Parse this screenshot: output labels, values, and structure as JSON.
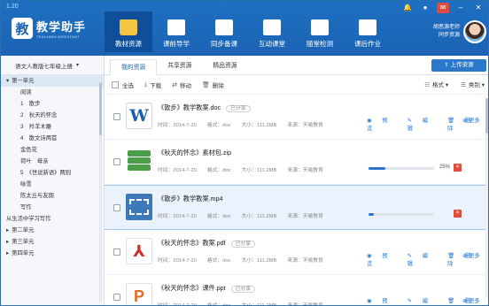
{
  "header": {
    "version": "1.20",
    "logo_glyph": "教",
    "app_title": "教学助手",
    "app_subtitle": "TEACHING ASSISTANT",
    "nav": [
      {
        "label": "教材资源",
        "icon": "folder-icon",
        "active": true
      },
      {
        "label": "课前导学",
        "icon": "book-icon",
        "active": false
      },
      {
        "label": "同步备课",
        "icon": "lesson-prep-icon",
        "active": false
      },
      {
        "label": "互动课堂",
        "icon": "classroom-icon",
        "active": false
      },
      {
        "label": "随堂检测",
        "icon": "quiz-icon",
        "active": false
      },
      {
        "label": "课后作业",
        "icon": "homework-icon",
        "active": false
      }
    ],
    "window_controls": [
      "bell-icon",
      "pin-icon",
      "mail-icon",
      "minimize-icon",
      "close-icon"
    ],
    "user_name": "胡思源老师",
    "user_sub": "同步资源"
  },
  "sidebar": {
    "book_selector": "语文人教版七年级上册",
    "tree": [
      {
        "label": "第一单元",
        "level": 0,
        "expander": "▾",
        "selected": true
      },
      {
        "label": "阅读",
        "level": 1
      },
      {
        "label": "1　散步",
        "level": 1
      },
      {
        "label": "2　秋天的怀念",
        "level": 1
      },
      {
        "label": "3　羚羊木雕",
        "level": 1
      },
      {
        "label": "4　散文诗两首",
        "level": 1
      },
      {
        "label": "金色花",
        "level": 1
      },
      {
        "label": "荷叶　母亲",
        "level": 1
      },
      {
        "label": "5　《世说新语》两则",
        "level": 1
      },
      {
        "label": "咏雪",
        "level": 1
      },
      {
        "label": "陈太丘与友期",
        "level": 1
      },
      {
        "label": "写作",
        "level": 1
      },
      {
        "label": "从生活中学习写作",
        "level": 0,
        "expander": ""
      },
      {
        "label": "第二单元",
        "level": 0,
        "expander": "▸"
      },
      {
        "label": "第三单元",
        "level": 0,
        "expander": "▸"
      },
      {
        "label": "第四单元",
        "level": 0,
        "expander": "▸"
      }
    ]
  },
  "tabs": [
    {
      "label": "我的资源",
      "active": true
    },
    {
      "label": "共享资源",
      "active": false
    },
    {
      "label": "精品资源",
      "active": false
    }
  ],
  "upload_label": "上传资源",
  "toolbar": {
    "select_all": "全选",
    "download": "下载",
    "move": "移动",
    "delete": "删除",
    "view": "格式",
    "sort": "类别"
  },
  "files": [
    {
      "name": "《散步》教学教案.doc",
      "tag": "已分享",
      "icon": "word-icon",
      "time": "时间：2014-7-20",
      "format": "格式：doc",
      "size": "大小：111.2MB",
      "source": "来源：天喻教育",
      "mode": "actions"
    },
    {
      "name": "《秋天的怀念》素材包.zip",
      "tag": "",
      "icon": "zip-icon",
      "time": "时间：2014-7-20",
      "format": "格式：doc",
      "size": "大小：111.2MB",
      "source": "来源：天喻教育",
      "mode": "progress",
      "progress": 0.25,
      "pct": "25%"
    },
    {
      "name": "《散步》教学教案.mp4",
      "tag": "",
      "icon": "video-icon",
      "time": "时间：2014-7-20",
      "format": "格式：doc",
      "size": "大小：111.2MB",
      "source": "来源：天喻教育",
      "mode": "progress",
      "progress": 0.08,
      "pct": ""
    },
    {
      "name": "《秋天的怀念》教案.pdf",
      "tag": "已分享",
      "icon": "pdf-icon",
      "time": "时间：2014-7-20",
      "format": "格式：doc",
      "size": "大小：111.2MB",
      "source": "来源：天喻教育",
      "mode": "actions"
    },
    {
      "name": "《秋天的怀念》课件.ppt",
      "tag": "已分享",
      "icon": "ppt-icon",
      "time": "时间：2014-7-20",
      "format": "格式：doc",
      "size": "大小：111.2MB",
      "source": "来源：天喻教育",
      "mode": "actions"
    }
  ],
  "actions": {
    "preview": "预览",
    "edit": "编辑",
    "delete": "删除",
    "more": "更多"
  },
  "colors": {
    "brand": "#1b63b4",
    "accent": "#2a77cc",
    "danger": "#e04c3c"
  }
}
